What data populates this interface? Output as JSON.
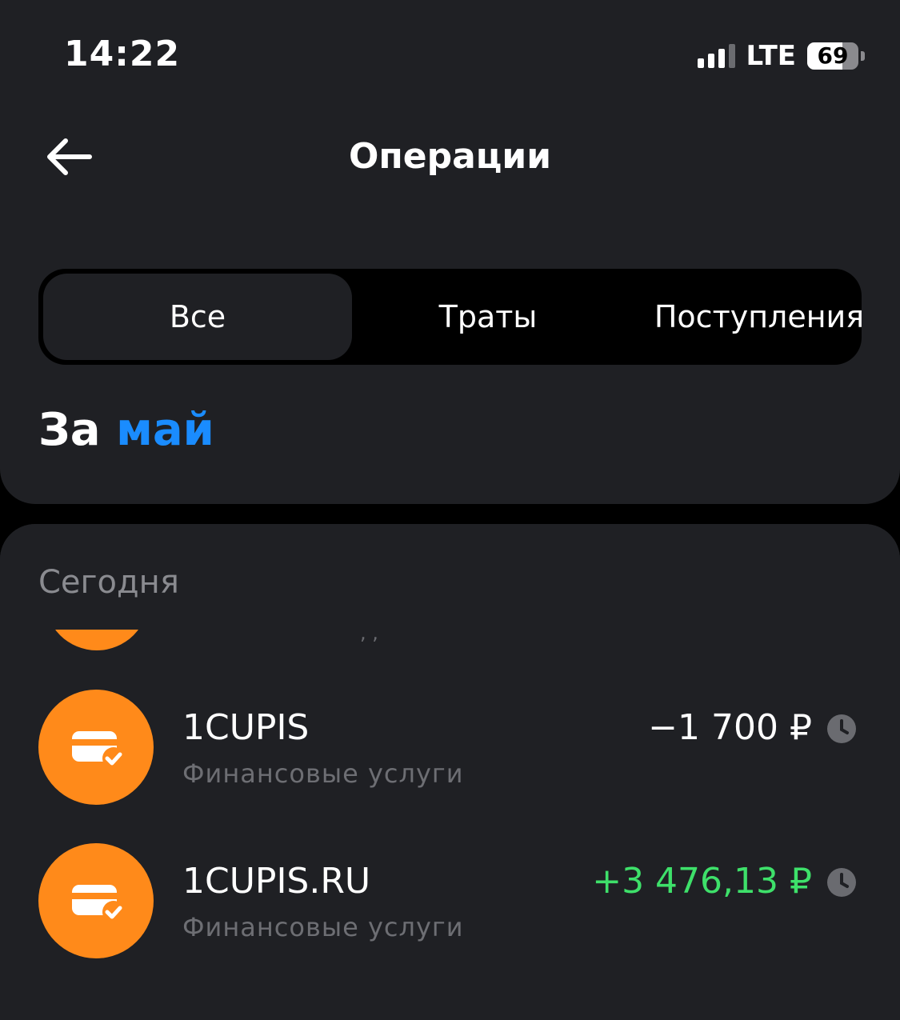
{
  "status_bar": {
    "time": "14:22",
    "network": "LTE",
    "battery": "69",
    "battery_level": 0.69
  },
  "header": {
    "title": "Операции",
    "back_icon": "arrow-left-icon"
  },
  "filter_tabs": [
    {
      "label": "Все",
      "active": true
    },
    {
      "label": "Траты",
      "active": false
    },
    {
      "label": "Поступления",
      "active": false
    }
  ],
  "period": {
    "prefix": "За",
    "month": "май"
  },
  "section": {
    "title": "Сегодня"
  },
  "operations": [
    {
      "name": "1CUPIS",
      "category": "Финансовые услуги",
      "amount": "−1 700 ₽",
      "type": "expense",
      "icon": "card-check-icon",
      "status_icon": "clock-icon"
    },
    {
      "name": "1CUPIS.RU",
      "category": "Финансовые услуги",
      "amount": "+3 476,13 ₽",
      "type": "income",
      "icon": "card-check-icon",
      "status_icon": "clock-icon"
    }
  ],
  "colors": {
    "background": "#1f2024",
    "accent_blue": "#1a8cff",
    "icon_orange": "#ff8a1a",
    "income_green": "#3ee06a",
    "muted_text": "#8a8b90"
  }
}
